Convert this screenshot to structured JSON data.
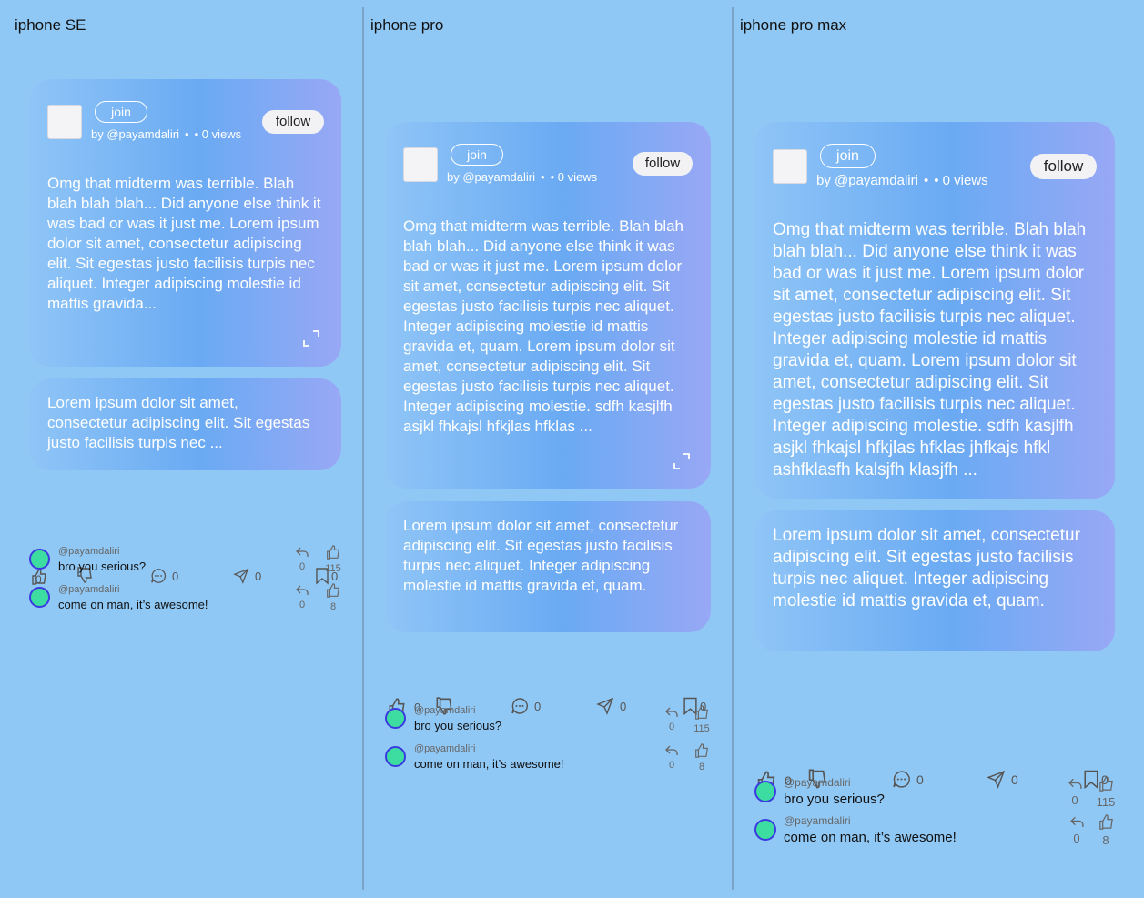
{
  "frames": [
    {
      "title": "iphone SE"
    },
    {
      "title": "iphone pro"
    },
    {
      "title": "iphone pro max"
    }
  ],
  "post": {
    "join_label": "join",
    "author": "by @payamdaliri",
    "dot": "•",
    "views": "• 0 views",
    "follow_label": "follow",
    "body_se": "Omg that midterm was terrible. Blah blah blah blah... Did anyone else think it was bad or was it just me. Lorem ipsum dolor sit amet, consectetur adipiscing elit. Sit egestas justo facilisis turpis nec aliquet. Integer adipiscing molestie id mattis gravida...",
    "body_pro": "Omg that midterm was terrible. Blah blah blah blah... Did anyone else think it was bad or was it just me. Lorem ipsum dolor sit amet, consectetur adipiscing elit. Sit egestas justo facilisis turpis nec aliquet. Integer adipiscing molestie id mattis gravida et, quam. Lorem ipsum dolor sit amet, consectetur adipiscing elit. Sit egestas justo facilisis turpis nec aliquet. Integer adipiscing molestie. sdfh kasjlfh asjkl fhkajsl hfkjlas hfklas ...",
    "body_promax": "Omg that midterm was terrible. Blah blah blah blah... Did anyone else think it was bad or was it just me. Lorem ipsum dolor sit amet, consectetur adipiscing elit. Sit egestas justo facilisis turpis nec aliquet. Integer adipiscing molestie id mattis gravida et, quam. Lorem ipsum dolor sit amet, consectetur adipiscing elit. Sit egestas justo facilisis turpis nec aliquet. Integer adipiscing molestie. sdfh kasjlfh asjkl fhkajsl hfkjlas hfklas jhfkajs hfkl ashfklasfh kalsjfh klasjfh ...",
    "icon": "expand-icon"
  },
  "reply": {
    "body_se": "Lorem ipsum dolor sit amet, consectetur adipiscing elit. Sit egestas justo facilisis turpis nec ...",
    "body_full": "Lorem ipsum dolor sit amet, consectetur adipiscing elit. Sit egestas justo facilisis turpis nec aliquet. Integer adipiscing molestie id mattis gravida et, quam."
  },
  "actions": {
    "like": "0",
    "dislike": "0",
    "comment": "0",
    "share": "0",
    "save": "0",
    "icons": [
      "thumbs-up-icon",
      "thumbs-down-icon",
      "comment-icon",
      "send-icon",
      "bookmark-icon"
    ]
  },
  "comments": [
    {
      "user": "@payamdaliri",
      "text": "bro you serious?",
      "replies": "0",
      "likes": "115"
    },
    {
      "user": "@payamdaliri",
      "text": "come on man, it’s awesome!",
      "replies": "0",
      "likes": "8"
    }
  ],
  "colors": {
    "background": "#90c8f5",
    "card_start": "#8fc5f7",
    "card_mid": "#6aaaf3",
    "card_end": "#98a8f5",
    "comment_avatar": "#3ddca0",
    "avatar_ring": "#3a3ae0"
  }
}
